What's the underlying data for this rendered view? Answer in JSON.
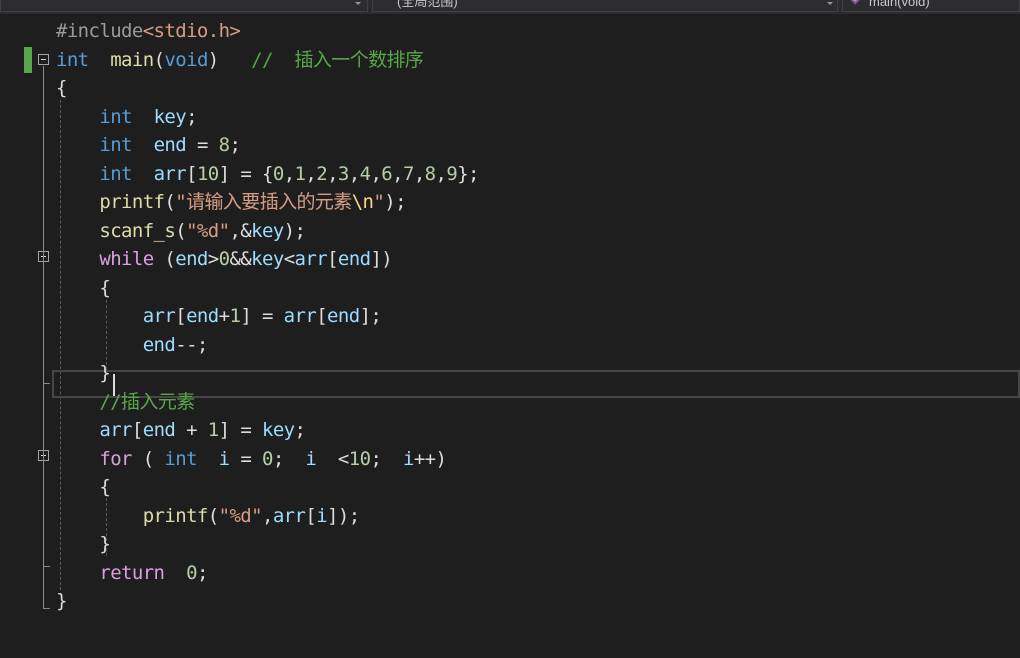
{
  "navigation": {
    "project_dropdown": "",
    "scope_dropdown": "(全局范围)",
    "function_dropdown": "main(void)"
  },
  "code_lines": [
    [
      [
        "pp",
        "#include"
      ],
      [
        "hdr",
        "<stdio.h>"
      ]
    ],
    [
      [
        "kw",
        "int"
      ],
      [
        "",
        "  "
      ],
      [
        "fn",
        "main"
      ],
      [
        "",
        "("
      ],
      [
        "kw",
        "void"
      ],
      [
        "",
        ")   "
      ],
      [
        "cmt",
        "//  插入一个数排序"
      ]
    ],
    [
      [
        "",
        "{"
      ]
    ],
    [
      [
        "",
        "    "
      ],
      [
        "kw",
        "int"
      ],
      [
        "",
        "  "
      ],
      [
        "var",
        "key"
      ],
      [
        "",
        ";"
      ]
    ],
    [
      [
        "",
        "    "
      ],
      [
        "kw",
        "int"
      ],
      [
        "",
        "  "
      ],
      [
        "var",
        "end"
      ],
      [
        "",
        " = "
      ],
      [
        "num",
        "8"
      ],
      [
        "",
        ";"
      ]
    ],
    [
      [
        "",
        "    "
      ],
      [
        "kw",
        "int"
      ],
      [
        "",
        "  "
      ],
      [
        "var",
        "arr"
      ],
      [
        "",
        "["
      ],
      [
        "num",
        "10"
      ],
      [
        "",
        "] = {"
      ],
      [
        "num",
        "0"
      ],
      [
        "",
        ","
      ],
      [
        "num",
        "1"
      ],
      [
        "",
        ","
      ],
      [
        "num",
        "2"
      ],
      [
        "",
        ","
      ],
      [
        "num",
        "3"
      ],
      [
        "",
        ","
      ],
      [
        "num",
        "4"
      ],
      [
        "",
        ","
      ],
      [
        "num",
        "6"
      ],
      [
        "",
        ","
      ],
      [
        "num",
        "7"
      ],
      [
        "",
        ","
      ],
      [
        "num",
        "8"
      ],
      [
        "",
        ","
      ],
      [
        "num",
        "9"
      ],
      [
        "",
        "};"
      ]
    ],
    [
      [
        "",
        "    "
      ],
      [
        "fn",
        "printf"
      ],
      [
        "",
        "("
      ],
      [
        "str",
        "\"请输入要插入的元素"
      ],
      [
        "esc",
        "\\n"
      ],
      [
        "str",
        "\""
      ],
      [
        "",
        ");"
      ]
    ],
    [
      [
        "",
        "    "
      ],
      [
        "fn",
        "scanf_s"
      ],
      [
        "",
        "("
      ],
      [
        "str",
        "\"%d\""
      ],
      [
        "",
        ",&"
      ],
      [
        "var",
        "key"
      ],
      [
        "",
        ");"
      ]
    ],
    [
      [
        "",
        "    "
      ],
      [
        "ctl",
        "while"
      ],
      [
        "",
        " ("
      ],
      [
        "var",
        "end"
      ],
      [
        "",
        ">"
      ],
      [
        "num",
        "0"
      ],
      [
        "",
        "&&"
      ],
      [
        "var",
        "key"
      ],
      [
        "",
        "<"
      ],
      [
        "var",
        "arr"
      ],
      [
        "",
        "["
      ],
      [
        "var",
        "end"
      ],
      [
        "",
        "])"
      ]
    ],
    [
      [
        "",
        "    {"
      ]
    ],
    [
      [
        "",
        "        "
      ],
      [
        "var",
        "arr"
      ],
      [
        "",
        "["
      ],
      [
        "var",
        "end"
      ],
      [
        "",
        "+"
      ],
      [
        "num",
        "1"
      ],
      [
        "",
        "] = "
      ],
      [
        "var",
        "arr"
      ],
      [
        "",
        "["
      ],
      [
        "var",
        "end"
      ],
      [
        "",
        "];"
      ]
    ],
    [
      [
        "",
        "        "
      ],
      [
        "var",
        "end"
      ],
      [
        "",
        "--;"
      ]
    ],
    [
      [
        "",
        "    }"
      ]
    ],
    [
      [
        "",
        "    "
      ],
      [
        "cmt",
        "//插入元素"
      ]
    ],
    [
      [
        "",
        "    "
      ],
      [
        "var",
        "arr"
      ],
      [
        "",
        "["
      ],
      [
        "var",
        "end"
      ],
      [
        "",
        " + "
      ],
      [
        "num",
        "1"
      ],
      [
        "",
        "] = "
      ],
      [
        "var",
        "key"
      ],
      [
        "",
        ";"
      ]
    ],
    [
      [
        "",
        "    "
      ],
      [
        "ctl",
        "for"
      ],
      [
        "",
        " ( "
      ],
      [
        "kw",
        "int"
      ],
      [
        "",
        "  "
      ],
      [
        "var",
        "i"
      ],
      [
        "",
        " = "
      ],
      [
        "num",
        "0"
      ],
      [
        "",
        ";  "
      ],
      [
        "var",
        "i"
      ],
      [
        "",
        "  <"
      ],
      [
        "num",
        "10"
      ],
      [
        "",
        ";  "
      ],
      [
        "var",
        "i"
      ],
      [
        "",
        "++)"
      ]
    ],
    [
      [
        "",
        "    {"
      ]
    ],
    [
      [
        "",
        "        "
      ],
      [
        "fn",
        "printf"
      ],
      [
        "",
        "("
      ],
      [
        "str",
        "\"%d\""
      ],
      [
        "",
        ","
      ],
      [
        "var",
        "arr"
      ],
      [
        "",
        "["
      ],
      [
        "var",
        "i"
      ],
      [
        "",
        "]);"
      ]
    ],
    [
      [
        "",
        "    }"
      ]
    ],
    [
      [
        "",
        "    "
      ],
      [
        "ctl",
        "return"
      ],
      [
        "",
        "  "
      ],
      [
        "num",
        "0"
      ],
      [
        "",
        ";"
      ]
    ],
    [
      [
        "",
        "}"
      ]
    ]
  ]
}
